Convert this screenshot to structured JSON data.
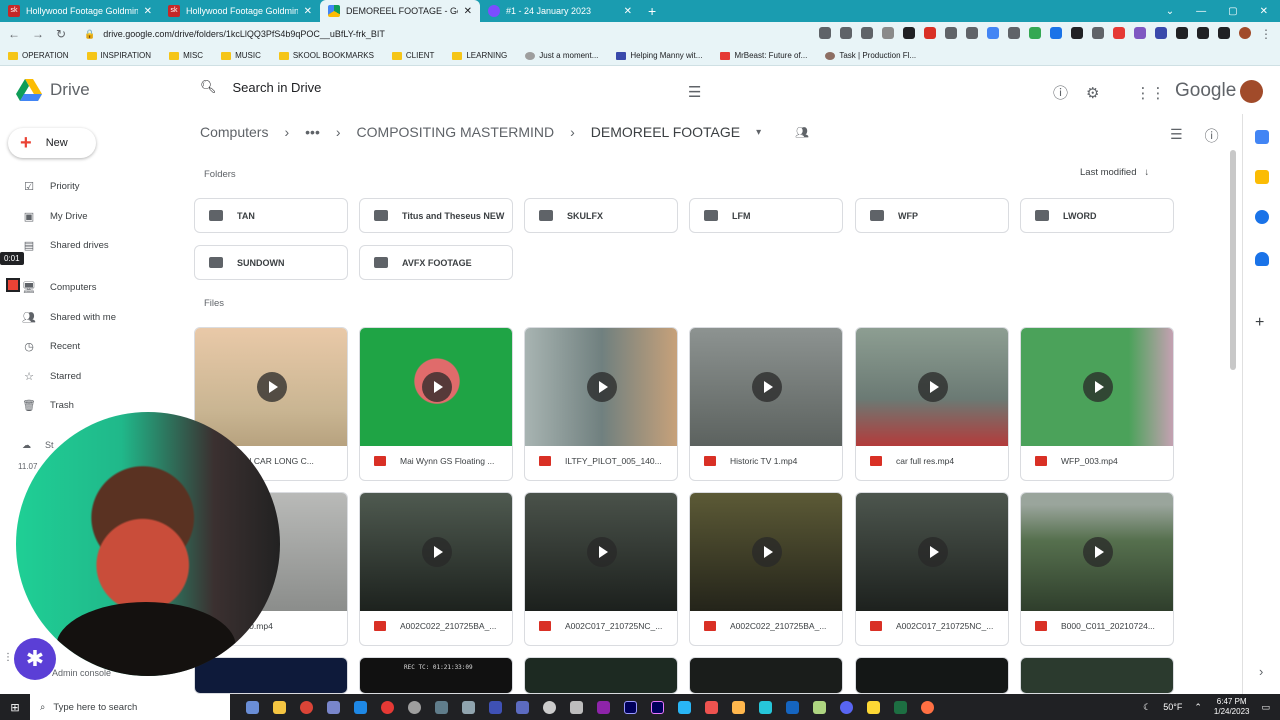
{
  "browser": {
    "tabs": [
      {
        "title": "Hollywood Footage Goldmine - S",
        "icon": "skool-icon"
      },
      {
        "title": "Hollywood Footage Goldmine - S",
        "icon": "skool-icon"
      },
      {
        "title": "DEMOREEL FOOTAGE - Google Dr",
        "icon": "drive-icon",
        "active": true
      },
      {
        "title": "#1 - 24 January 2023",
        "icon": "spark-icon"
      }
    ],
    "url": "drive.google.com/drive/folders/1kcLlQQ3PfS4b9qPOC__uBfLY-frk_BIT",
    "bookmarks": [
      "OPERATION",
      "INSPIRATION",
      "MISC",
      "MUSIC",
      "SKOOL BOOKMARKS",
      "CLIENT",
      "LEARNING",
      "Just a moment...",
      "Helping Manny wit...",
      "MrBeast: Future of...",
      "Task | Production Fl..."
    ]
  },
  "drive": {
    "app_name": "Drive",
    "search_placeholder": "Search in Drive",
    "google_wordmark": "Google",
    "new_label": "New",
    "nav": [
      {
        "label": "Priority",
        "icon": "check-circle-icon"
      },
      {
        "label": "My Drive",
        "icon": "my-drive-icon"
      },
      {
        "label": "Shared drives",
        "icon": "shared-drives-icon"
      },
      {
        "label": "Computers",
        "icon": "computer-icon"
      },
      {
        "label": "Shared with me",
        "icon": "people-icon"
      },
      {
        "label": "Recent",
        "icon": "clock-icon"
      },
      {
        "label": "Starred",
        "icon": "star-icon"
      },
      {
        "label": "Trash",
        "icon": "trash-icon"
      }
    ],
    "storage_label": "St",
    "storage_used": "11.07",
    "admin_console": "Admin console",
    "recording_timer": "0:01",
    "breadcrumb": [
      "Computers",
      "COMPOSITING MASTERMIND",
      "DEMOREEL FOOTAGE"
    ],
    "folders_heading": "Folders",
    "files_heading": "Files",
    "sort_label": "Last modified",
    "folders": [
      "TAN",
      "Titus and Theseus NEW",
      "SKULFX",
      "LFM",
      "WFP",
      "LWORD",
      "SUNDOWN",
      "AVFX FOOTAGE"
    ],
    "files": [
      {
        "name": "S IN CAR LONG C...",
        "color": "#d7c2a8"
      },
      {
        "name": "Mai Wynn GS Floating ...",
        "color": "#21a34a"
      },
      {
        "name": "ILTFY_PILOT_005_140...",
        "color": "#8c9a9c"
      },
      {
        "name": "Historic TV 1.mp4",
        "color": "#6f7775"
      },
      {
        "name": "car full res.mp4",
        "color": "#7c8d85"
      },
      {
        "name": "WFP_003.mp4",
        "color": "#4ba25a"
      },
      {
        "name": "_050.mp4",
        "color": "#9a9c9a"
      },
      {
        "name": "A002C022_210725BA_...",
        "color": "#323a34"
      },
      {
        "name": "A002C017_210725NC_...",
        "color": "#2f3631"
      },
      {
        "name": "A002C022_210725BA_...",
        "color": "#4a4a2c"
      },
      {
        "name": "A002C017_210725NC_...",
        "color": "#343b34"
      },
      {
        "name": "B000_C011_20210724...",
        "color": "#5d6f54"
      }
    ],
    "third_row_timecode": "REC TC: 01:21:33:09"
  },
  "taskbar": {
    "search_placeholder": "Type here to search",
    "weather": "50°F",
    "time": "6:47 PM",
    "date": "1/24/2023"
  }
}
